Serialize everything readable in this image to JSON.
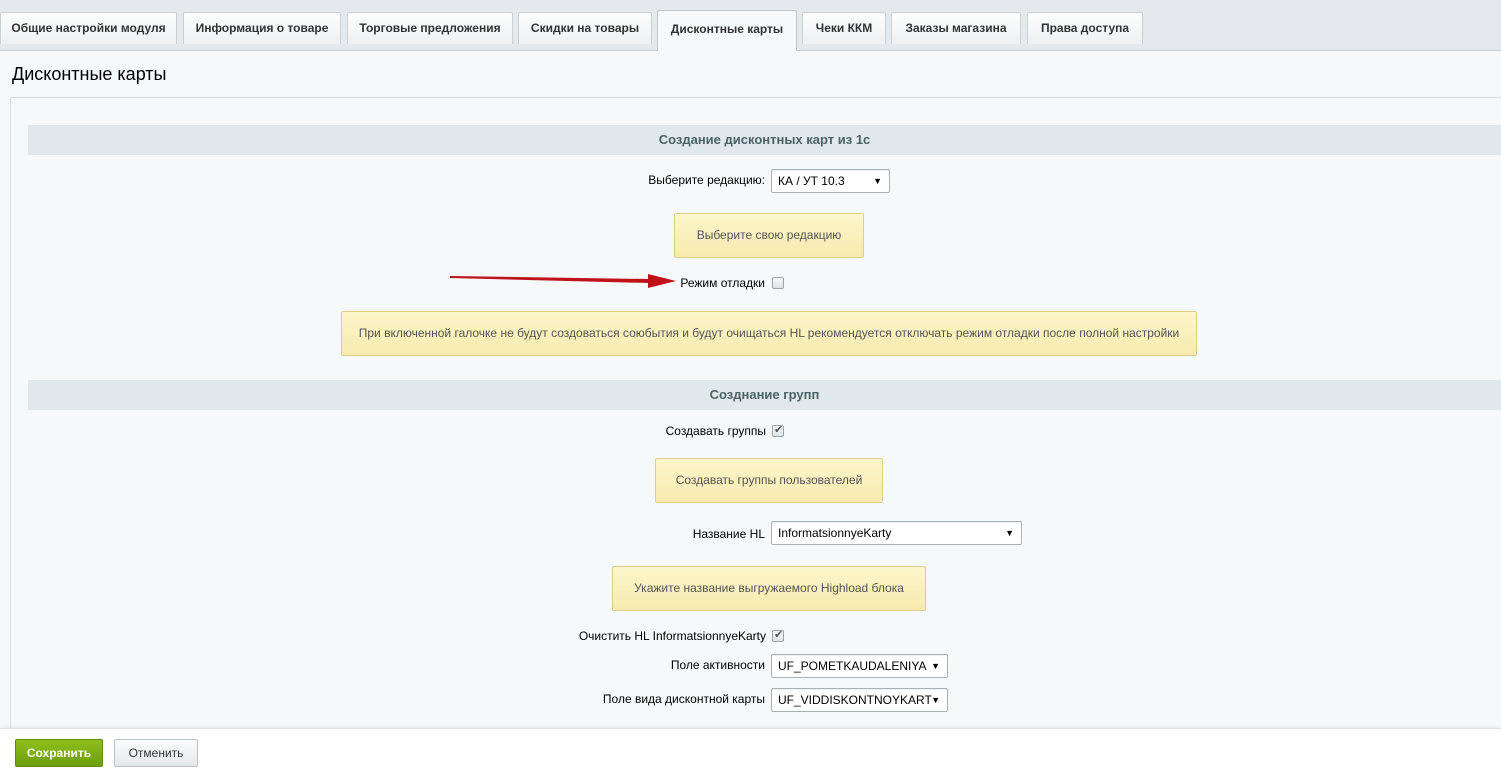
{
  "tabs": [
    {
      "label": "Общие настройки модуля"
    },
    {
      "label": "Информация о товаре"
    },
    {
      "label": "Торговые предложения"
    },
    {
      "label": "Скидки на товары"
    },
    {
      "label": "Дисконтные карты",
      "active": true
    },
    {
      "label": "Чеки ККМ"
    },
    {
      "label": "Заказы магазина"
    },
    {
      "label": "Права доступа"
    }
  ],
  "page": {
    "title": "Дисконтные карты"
  },
  "section1": {
    "title": "Создание дисконтных карт из 1с",
    "edition_label": "Выберите редакцию:",
    "edition_value": "КА / УТ 10.3",
    "edition_hint": "Выберите свою редакцию",
    "debug_label": "Режим отладки",
    "debug_checked": false,
    "debug_hint": "При включенной галочке не будут создоваться союбытия и будут очищаться HL рекомендуется отключать режим отладки после полной настройки"
  },
  "section2": {
    "title": "Созднание групп",
    "create_groups_label": "Создавать группы",
    "create_groups_checked": true,
    "create_groups_hint": "Создавать группы пользователей",
    "hl_name_label": "Название HL",
    "hl_name_value": "InformatsionnyeKarty",
    "hl_name_hint": "Укажите название выгружаемого Highload блока",
    "clear_hl_label": "Очистить HL InformatsionnyeKarty",
    "clear_hl_checked": true,
    "activity_field_label": "Поле активности",
    "activity_field_value": "UF_POMETKAUDALENIYA",
    "card_type_field_label": "Поле вида дисконтной карты",
    "card_type_field_value": "UF_VIDDISKONTNOYKART"
  },
  "footer": {
    "save_label": "Сохранить",
    "cancel_label": "Отменить"
  },
  "colors": {
    "save_button": "#7cb015",
    "arrow": "#c0121a",
    "hint_bg": "#fdf5c6"
  },
  "icons": {
    "caret": "caret-down-icon",
    "check": "check-icon",
    "arrow": "red-arrow-annotation-icon"
  }
}
